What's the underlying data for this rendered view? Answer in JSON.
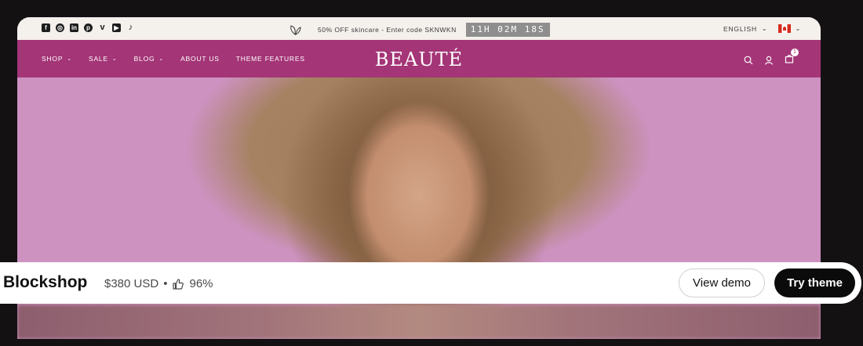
{
  "topbar": {
    "socials": [
      "facebook-icon",
      "instagram-icon",
      "linkedin-icon",
      "pinterest-icon",
      "vimeo-icon",
      "youtube-icon",
      "tiktok-icon"
    ],
    "promo_text": "50% OFF skincare - Enter code SKNWKN",
    "timer": "11H 02M 18S",
    "language": "ENGLISH"
  },
  "nav": {
    "links": [
      {
        "label": "SHOP",
        "dropdown": true
      },
      {
        "label": "SALE",
        "dropdown": true
      },
      {
        "label": "BLOG",
        "dropdown": true
      },
      {
        "label": "ABOUT US",
        "dropdown": false
      },
      {
        "label": "THEME FEATURES",
        "dropdown": false
      }
    ],
    "brand": "BEAUTÉ",
    "cart_count": "1"
  },
  "theme": {
    "name": "Blockshop",
    "price": "$380 USD",
    "separator": "•",
    "rating": "96%",
    "view_demo": "View demo",
    "try_theme": "Try theme"
  },
  "colors": {
    "nav_bg": "#a43577",
    "hero_bg": "#cd92c0",
    "try_button": "#0b0b0b"
  }
}
